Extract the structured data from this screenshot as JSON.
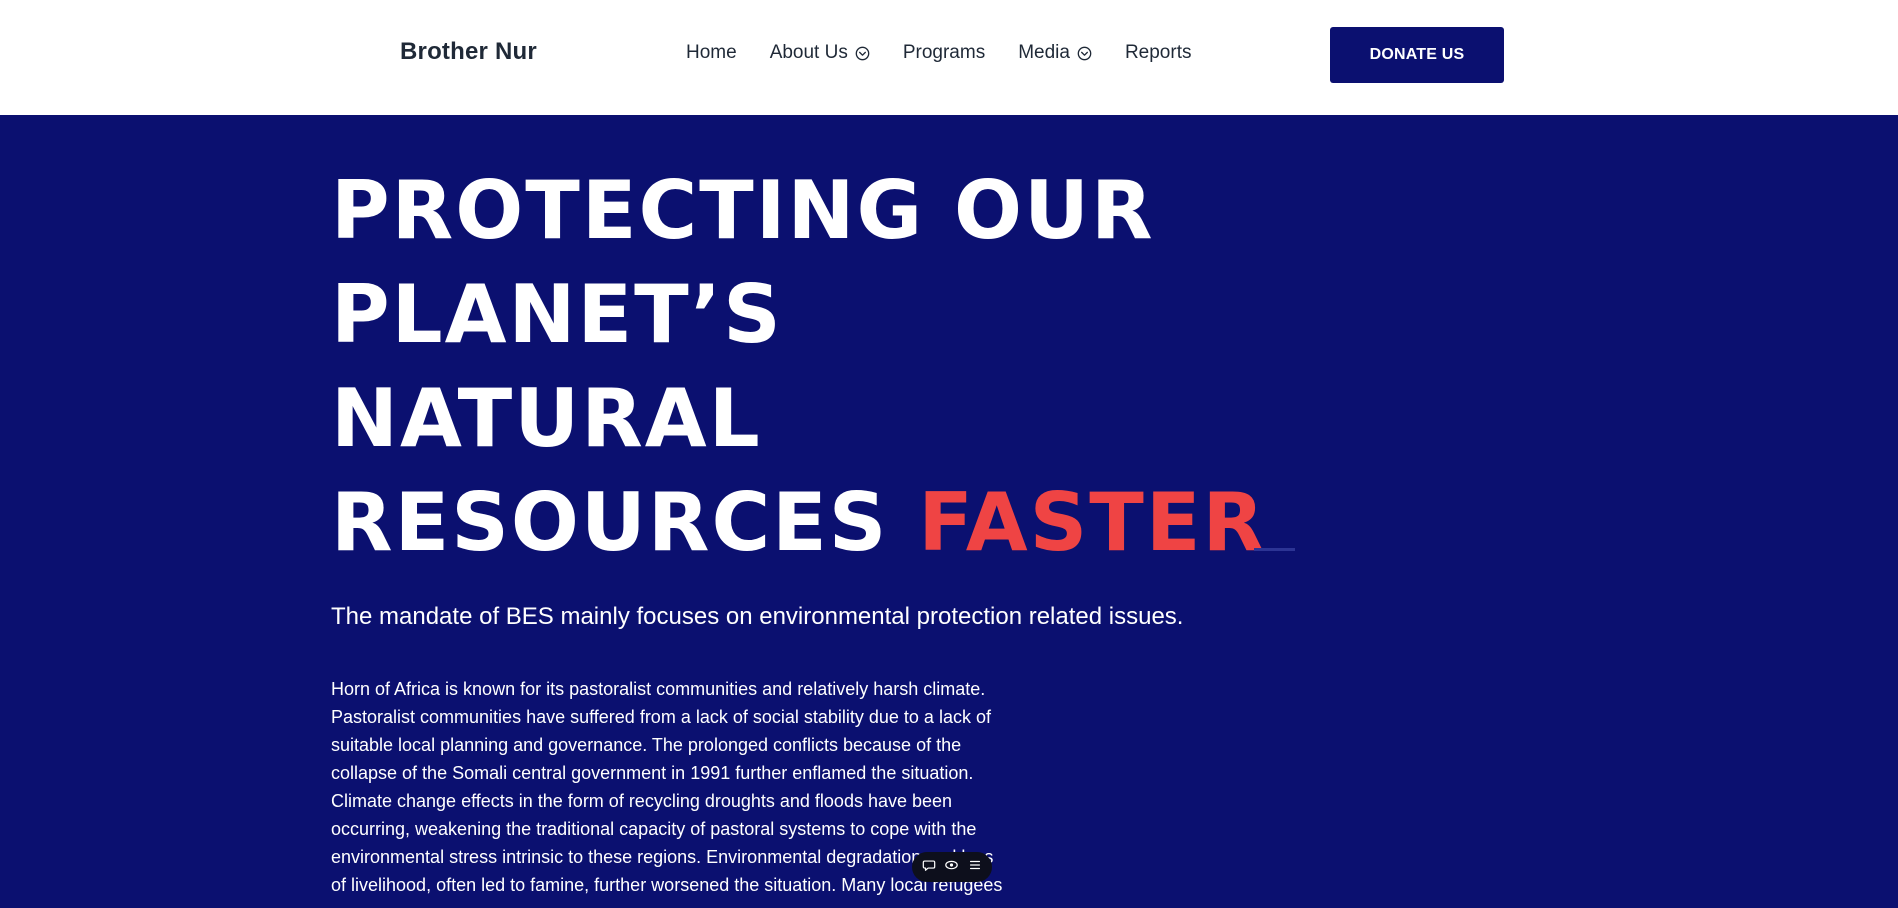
{
  "header": {
    "brand": "Brother Nur",
    "nav": [
      {
        "label": "Home",
        "has_dropdown": false
      },
      {
        "label": "About Us",
        "has_dropdown": true,
        "icon": "chevron-down-circle-icon"
      },
      {
        "label": "Programs",
        "has_dropdown": false
      },
      {
        "label": "Media",
        "has_dropdown": true,
        "icon": "chevron-down-circle-icon"
      },
      {
        "label": "Reports",
        "has_dropdown": false
      }
    ],
    "donate_label": "DONATE US"
  },
  "hero": {
    "headline_lines": [
      "PROTECTING OUR",
      "PLANET’S",
      "NATURAL",
      "RESOURCES"
    ],
    "headline_accent": "FASTER",
    "mandate": "The mandate of BES mainly focuses on environmental protection related issues.",
    "body": "Horn of Africa is known for its pastoralist communities and relatively harsh climate. Pastoralist communities have suffered from a lack of social stability due to a lack of suitable local planning and governance. The prolonged conflicts because of the collapse of the Somali central government in 1991 further enflamed the situation. Climate change effects in the form of recycling droughts and floods have been occurring, weakening the traditional capacity of pastoral systems to cope with the environmental stress intrinsic to these regions. Environmental degradation and loss of livelihood, often led to famine, further worsened the situation. Many local refugees"
  },
  "floating_toolbar": {
    "icons": [
      "comment-icon",
      "eye-icon",
      "menu-icon"
    ]
  },
  "colors": {
    "navy": "#0b1070",
    "accent": "#ef4444",
    "header_bg": "#ffffff",
    "nav_text": "#1f2937"
  }
}
